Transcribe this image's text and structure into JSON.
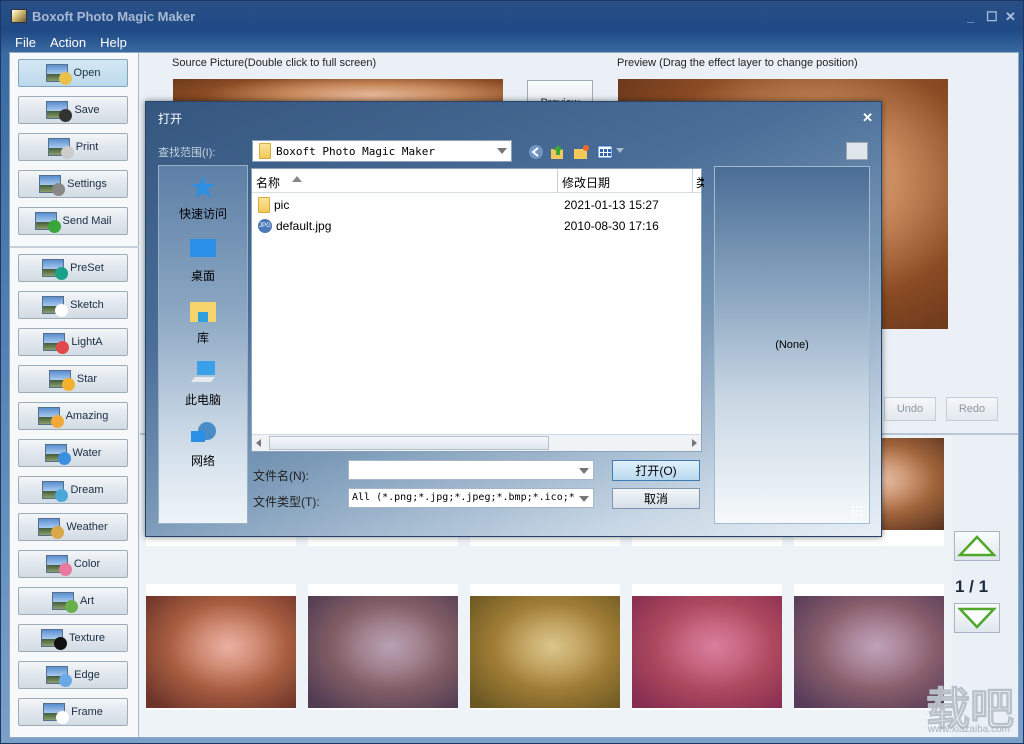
{
  "window": {
    "title": "Boxoft Photo Magic Maker",
    "controls": {
      "minimize": "_",
      "maximize": "☐",
      "close": "✕"
    }
  },
  "menu": [
    "File",
    "Action",
    "Help"
  ],
  "sidebar": {
    "top_buttons": [
      {
        "label": "Open",
        "icon": "open-folder-icon",
        "active": true
      },
      {
        "label": "Save",
        "icon": "floppy-disk-icon"
      },
      {
        "label": "Print",
        "icon": "printer-icon"
      },
      {
        "label": "Settings",
        "icon": "gear-icon"
      },
      {
        "label": "Send Mail",
        "icon": "send-mail-icon"
      }
    ],
    "effect_buttons": [
      {
        "label": "PreSet",
        "icon": "preset-icon"
      },
      {
        "label": "Sketch",
        "icon": "sketch-icon"
      },
      {
        "label": "LightA",
        "icon": "light-icon"
      },
      {
        "label": "Star",
        "icon": "star-icon"
      },
      {
        "label": "Amazing",
        "icon": "smiley-icon"
      },
      {
        "label": "Water",
        "icon": "water-drop-icon"
      },
      {
        "label": "Dream",
        "icon": "dream-icon"
      },
      {
        "label": "Weather",
        "icon": "weather-icon"
      },
      {
        "label": "Color",
        "icon": "palette-icon"
      },
      {
        "label": "Art",
        "icon": "art-icon"
      },
      {
        "label": "Texture",
        "icon": "texture-icon"
      },
      {
        "label": "Edge",
        "icon": "edge-icon"
      },
      {
        "label": "Frame",
        "icon": "frame-icon"
      }
    ]
  },
  "main": {
    "source_label": "Source Picture(Double click to full screen)",
    "preview_label": "Preview (Drag the effect layer to change position)",
    "preview_button": "Preview",
    "undo": "Undo",
    "redo": "Redo",
    "page_indicator": "1 / 1",
    "watermark": "载吧",
    "watermark_url": "www.xiazaiba.com"
  },
  "dialog": {
    "title": "打开",
    "close": "✕",
    "look_in_label": "查找范围(I):",
    "look_in_value": "Boxoft Photo Magic Maker",
    "places": [
      "快速访问",
      "桌面",
      "库",
      "此电脑",
      "网络"
    ],
    "columns": {
      "name": "名称",
      "modified": "修改日期",
      "type": "类"
    },
    "files": [
      {
        "name": "pic",
        "modified": "2021-01-13 15:27",
        "kind": "folder"
      },
      {
        "name": "default.jpg",
        "modified": "2010-08-30 17:16",
        "kind": "jpg"
      }
    ],
    "filename_label": "文件名(N):",
    "filename_value": "",
    "filetype_label": "文件类型(T):",
    "filetype_value": "All (*.png;*.jpg;*.jpeg;*.bmp;*.ico;*",
    "open_button": "打开(O)",
    "cancel_button": "取消",
    "preview_text": "(None)"
  }
}
